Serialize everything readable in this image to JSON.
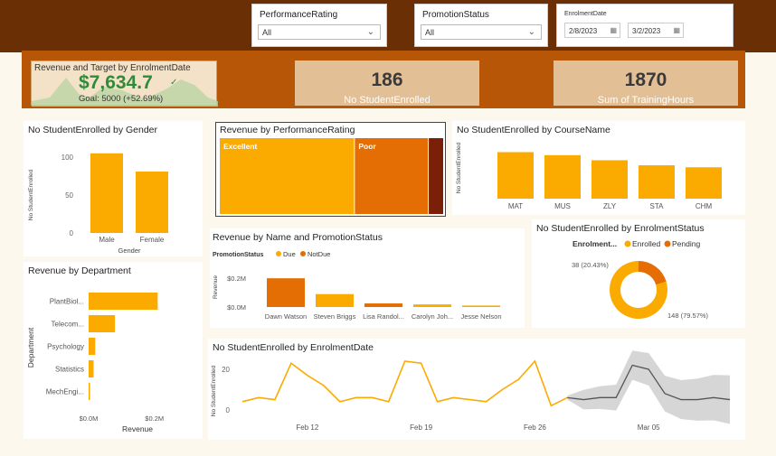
{
  "filters": {
    "performance": {
      "label": "PerformanceRating",
      "value": "All"
    },
    "promotion": {
      "label": "PromotionStatus",
      "value": "All"
    },
    "enrolment": {
      "label": "EnrolmentDate",
      "start": "2/8/2023",
      "end": "3/2/2023"
    }
  },
  "kpis": {
    "revenue_target": {
      "title": "Revenue and Target by EnrolmentDate",
      "value": "$7,634.7",
      "goal": "Goal: 5000 (+52.69%)"
    },
    "students": {
      "value": "186",
      "label": "No StudentEnrolled"
    },
    "training": {
      "value": "1870",
      "label": "Sum of TrainingHours"
    }
  },
  "colors": {
    "primary": "#fbab00",
    "secondary": "#e46e04",
    "dark": "#7a1f08",
    "forecast": "#555555"
  },
  "chart_data": [
    {
      "id": "gender",
      "type": "bar",
      "title": "No StudentEnrolled by Gender",
      "categories": [
        "Male",
        "Female"
      ],
      "values": [
        105,
        81
      ],
      "xlabel": "Gender",
      "ylabel": "No StudentEnrolled",
      "ylim": [
        0,
        100
      ],
      "yticks": [
        "0",
        "50",
        "100"
      ]
    },
    {
      "id": "performance",
      "type": "treemap",
      "title": "Revenue by PerformanceRating",
      "items": [
        {
          "label": "Excellent",
          "value": 0.53,
          "color": "#fbab00"
        },
        {
          "label": "Poor",
          "value": 0.29,
          "color": "#e46e04"
        },
        {
          "label": "",
          "value": 0.06,
          "color": "#7a1f08"
        }
      ]
    },
    {
      "id": "course",
      "type": "bar",
      "title": "No StudentEnrolled by CourseName",
      "categories": [
        "MAT",
        "MUS",
        "ZLY",
        "STA",
        "CHM"
      ],
      "values": [
        46,
        43,
        38,
        33,
        31
      ],
      "ylabel": "No StudentEnrolled",
      "ylim": [
        0,
        50
      ]
    },
    {
      "id": "department",
      "type": "hbar",
      "title": "Revenue by Department",
      "categories": [
        "PlantBiol...",
        "Telecom...",
        "Psychology",
        "Statistics",
        "MechEngi..."
      ],
      "values": [
        0.21,
        0.08,
        0.02,
        0.015,
        0.004
      ],
      "xlabel": "Revenue",
      "ylabel": "Department",
      "xticks": [
        "$0.0M",
        "$0.2M"
      ],
      "xlim": [
        0,
        0.22
      ]
    },
    {
      "id": "name_promo",
      "type": "bar",
      "title": "Revenue by Name and PromotionStatus",
      "legend_title": "PromotionStatus",
      "legend": [
        "Due",
        "NotDue"
      ],
      "categories": [
        "Dawn Watson",
        "Steven Briggs",
        "Lisa Randol...",
        "Carolyn Joh...",
        "Jesse Nelson"
      ],
      "values": [
        0.2,
        0.09,
        0.025,
        0.018,
        0.01
      ],
      "series_of": [
        "NotDue",
        "Due",
        "NotDue",
        "Due",
        "Due"
      ],
      "ylabel": "Revenue",
      "yticks": [
        "$0.0M",
        "$0.2M"
      ],
      "ylim": [
        0,
        0.22
      ]
    },
    {
      "id": "status",
      "type": "pie",
      "title": "No StudentEnrolled by EnrolmentStatus",
      "legend_title": "Enrolment...",
      "legend": [
        "Enrolled",
        "Pending"
      ],
      "values": [
        148,
        38
      ],
      "labels": [
        "148 (79.57%)",
        "38 (20.43%)"
      ]
    },
    {
      "id": "date",
      "type": "line",
      "title": "No StudentEnrolled by EnrolmentDate",
      "ylabel": "No StudentEnrolled",
      "yticks": [
        "0",
        "20"
      ],
      "ylim": [
        -5,
        28
      ],
      "xticks": [
        "Feb 12",
        "Feb 19",
        "Feb 26",
        "Mar 05"
      ],
      "x": [
        "2023-02-08",
        "2023-02-09",
        "2023-02-10",
        "2023-02-11",
        "2023-02-12",
        "2023-02-13",
        "2023-02-14",
        "2023-02-15",
        "2023-02-16",
        "2023-02-17",
        "2023-02-18",
        "2023-02-19",
        "2023-02-20",
        "2023-02-21",
        "2023-02-22",
        "2023-02-23",
        "2023-02-24",
        "2023-02-25",
        "2023-02-26",
        "2023-02-27",
        "2023-02-28"
      ],
      "values": [
        4,
        6,
        5,
        23,
        17,
        12,
        4,
        6,
        6,
        4,
        24,
        23,
        4,
        6,
        5,
        4,
        10,
        15,
        24,
        2,
        6
      ],
      "forecast_x": [
        "2023-02-28",
        "2023-03-01",
        "2023-03-02",
        "2023-03-03",
        "2023-03-04",
        "2023-03-05",
        "2023-03-06",
        "2023-03-07",
        "2023-03-08",
        "2023-03-09",
        "2023-03-10"
      ],
      "forecast": [
        6,
        5,
        6,
        6,
        22,
        20,
        8,
        5,
        5,
        6,
        5
      ]
    }
  ]
}
